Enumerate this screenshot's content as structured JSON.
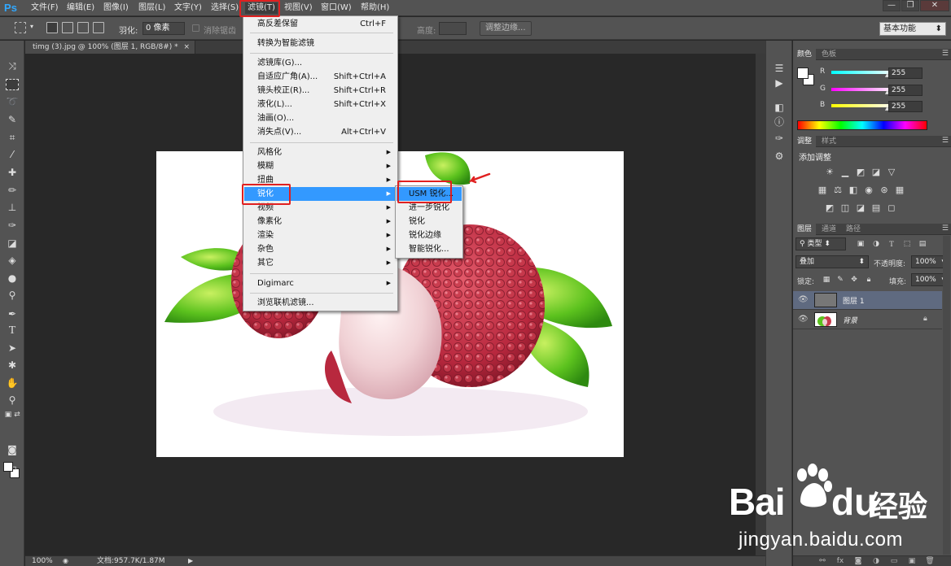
{
  "app": {
    "logo": "Ps"
  },
  "menubar": {
    "items": [
      "文件(F)",
      "编辑(E)",
      "图像(I)",
      "图层(L)",
      "文字(Y)",
      "选择(S)",
      "滤镜(T)",
      "视图(V)",
      "窗口(W)",
      "帮助(H)"
    ],
    "window_controls": [
      "—",
      "❐",
      "✕"
    ]
  },
  "options": {
    "feather_label": "羽化:",
    "feather_value": "0 像素",
    "antialias_label": "消除锯齿",
    "height_label": "高度:",
    "refine_edge_button": "调整边缘...",
    "workspace": "基本功能"
  },
  "document": {
    "tab_title": "timg (3).jpg @ 100% (图层 1, RGB/8#) *",
    "tab_close": "×"
  },
  "status": {
    "zoom": "100%",
    "doc_info": "文档:957.7K/1.87M"
  },
  "filter_menu": {
    "items": [
      {
        "label": "高反差保留",
        "shortcut": "Ctrl+F"
      },
      {
        "label": "转换为智能滤镜",
        "shortcut": ""
      },
      {
        "label": "滤镜库(G)...",
        "shortcut": ""
      },
      {
        "label": "自适应广角(A)...",
        "shortcut": "Shift+Ctrl+A"
      },
      {
        "label": "镜头校正(R)...",
        "shortcut": "Shift+Ctrl+R"
      },
      {
        "label": "液化(L)...",
        "shortcut": "Shift+Ctrl+X"
      },
      {
        "label": "油画(O)...",
        "shortcut": ""
      },
      {
        "label": "消失点(V)...",
        "shortcut": "Alt+Ctrl+V"
      },
      {
        "label": "风格化",
        "shortcut": ""
      },
      {
        "label": "模糊",
        "shortcut": ""
      },
      {
        "label": "扭曲",
        "shortcut": ""
      },
      {
        "label": "锐化",
        "shortcut": ""
      },
      {
        "label": "视频",
        "shortcut": ""
      },
      {
        "label": "像素化",
        "shortcut": ""
      },
      {
        "label": "渲染",
        "shortcut": ""
      },
      {
        "label": "杂色",
        "shortcut": ""
      },
      {
        "label": "其它",
        "shortcut": ""
      },
      {
        "label": "Digimarc",
        "shortcut": ""
      },
      {
        "label": "浏览联机滤镜...",
        "shortcut": ""
      }
    ]
  },
  "sharpen_submenu": {
    "items": [
      "USM 锐化...",
      "进一步锐化",
      "锐化",
      "锐化边缘",
      "智能锐化..."
    ]
  },
  "color_panel": {
    "tabs": [
      "颜色",
      "色板"
    ],
    "channels": [
      {
        "label": "R",
        "value": "255",
        "color": "#ff0000"
      },
      {
        "label": "G",
        "value": "255",
        "color": "#00ff00"
      },
      {
        "label": "B",
        "value": "255",
        "color": "#0000ff"
      }
    ]
  },
  "adjust_panel": {
    "tabs": [
      "调整",
      "样式"
    ],
    "title": "添加调整"
  },
  "layers_panel": {
    "tabs": [
      "图层",
      "通道",
      "路径"
    ],
    "kind_filter": "类型",
    "blend_mode": "叠加",
    "opacity_label": "不透明度:",
    "opacity_value": "100%",
    "lock_label": "锁定:",
    "fill_label": "填充:",
    "fill_value": "100%",
    "layers": [
      {
        "name": "图层 1",
        "selected": true
      },
      {
        "name": "背景",
        "selected": false,
        "locked": true
      }
    ]
  },
  "watermark": {
    "bai": "Bai",
    "du": "du",
    "brand_cn": "经验",
    "url": "jingyan.baidu.com"
  },
  "colors": {
    "highlight": "#3399ff",
    "annotation_red": "#e02020",
    "ps_blue": "#31a8ff"
  }
}
